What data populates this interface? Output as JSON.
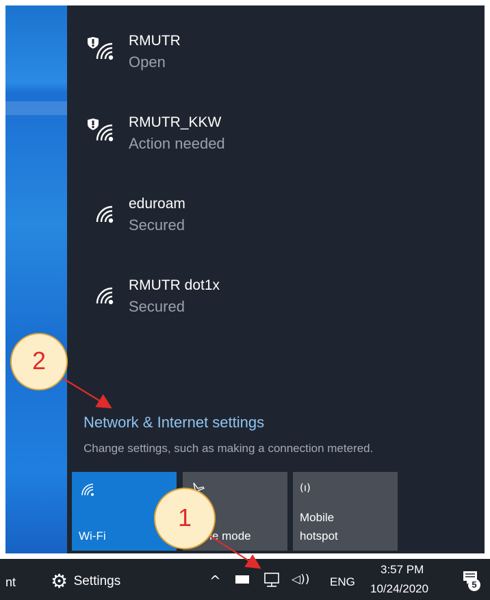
{
  "networks": [
    {
      "name": "RMUTR",
      "status": "Open",
      "icon": "wifi-shield-icon"
    },
    {
      "name": "RMUTR_KKW",
      "status": "Action needed",
      "icon": "wifi-shield-icon"
    },
    {
      "name": "eduroam",
      "status": "Secured",
      "icon": "wifi-icon"
    },
    {
      "name": "RMUTR dot1x",
      "status": "Secured",
      "icon": "wifi-icon"
    }
  ],
  "settings": {
    "title": "Network & Internet settings",
    "description": "Change settings, such as making a connection metered."
  },
  "quick_actions": [
    {
      "label": "Wi-Fi",
      "active": true,
      "icon": "wifi-icon"
    },
    {
      "label": "Airplane mode",
      "active": false,
      "icon": "airplane-icon"
    },
    {
      "label": "Mobile hotspot",
      "active": false,
      "icon": "hotspot-icon"
    }
  ],
  "taskbar": {
    "left_fragment": "nt",
    "settings_label": "Settings",
    "language": "ENG",
    "time": "3:57 PM",
    "date": "10/24/2020",
    "notification_count": "5"
  },
  "annotations": {
    "callout_1": "1",
    "callout_2": "2"
  },
  "colors": {
    "panel_bg": "#1f2530",
    "accent": "#1479d2",
    "link": "#8fc4f2",
    "callout_fill": "#fdeec8",
    "callout_border": "#e0a633",
    "arrow": "#e22b2b"
  }
}
